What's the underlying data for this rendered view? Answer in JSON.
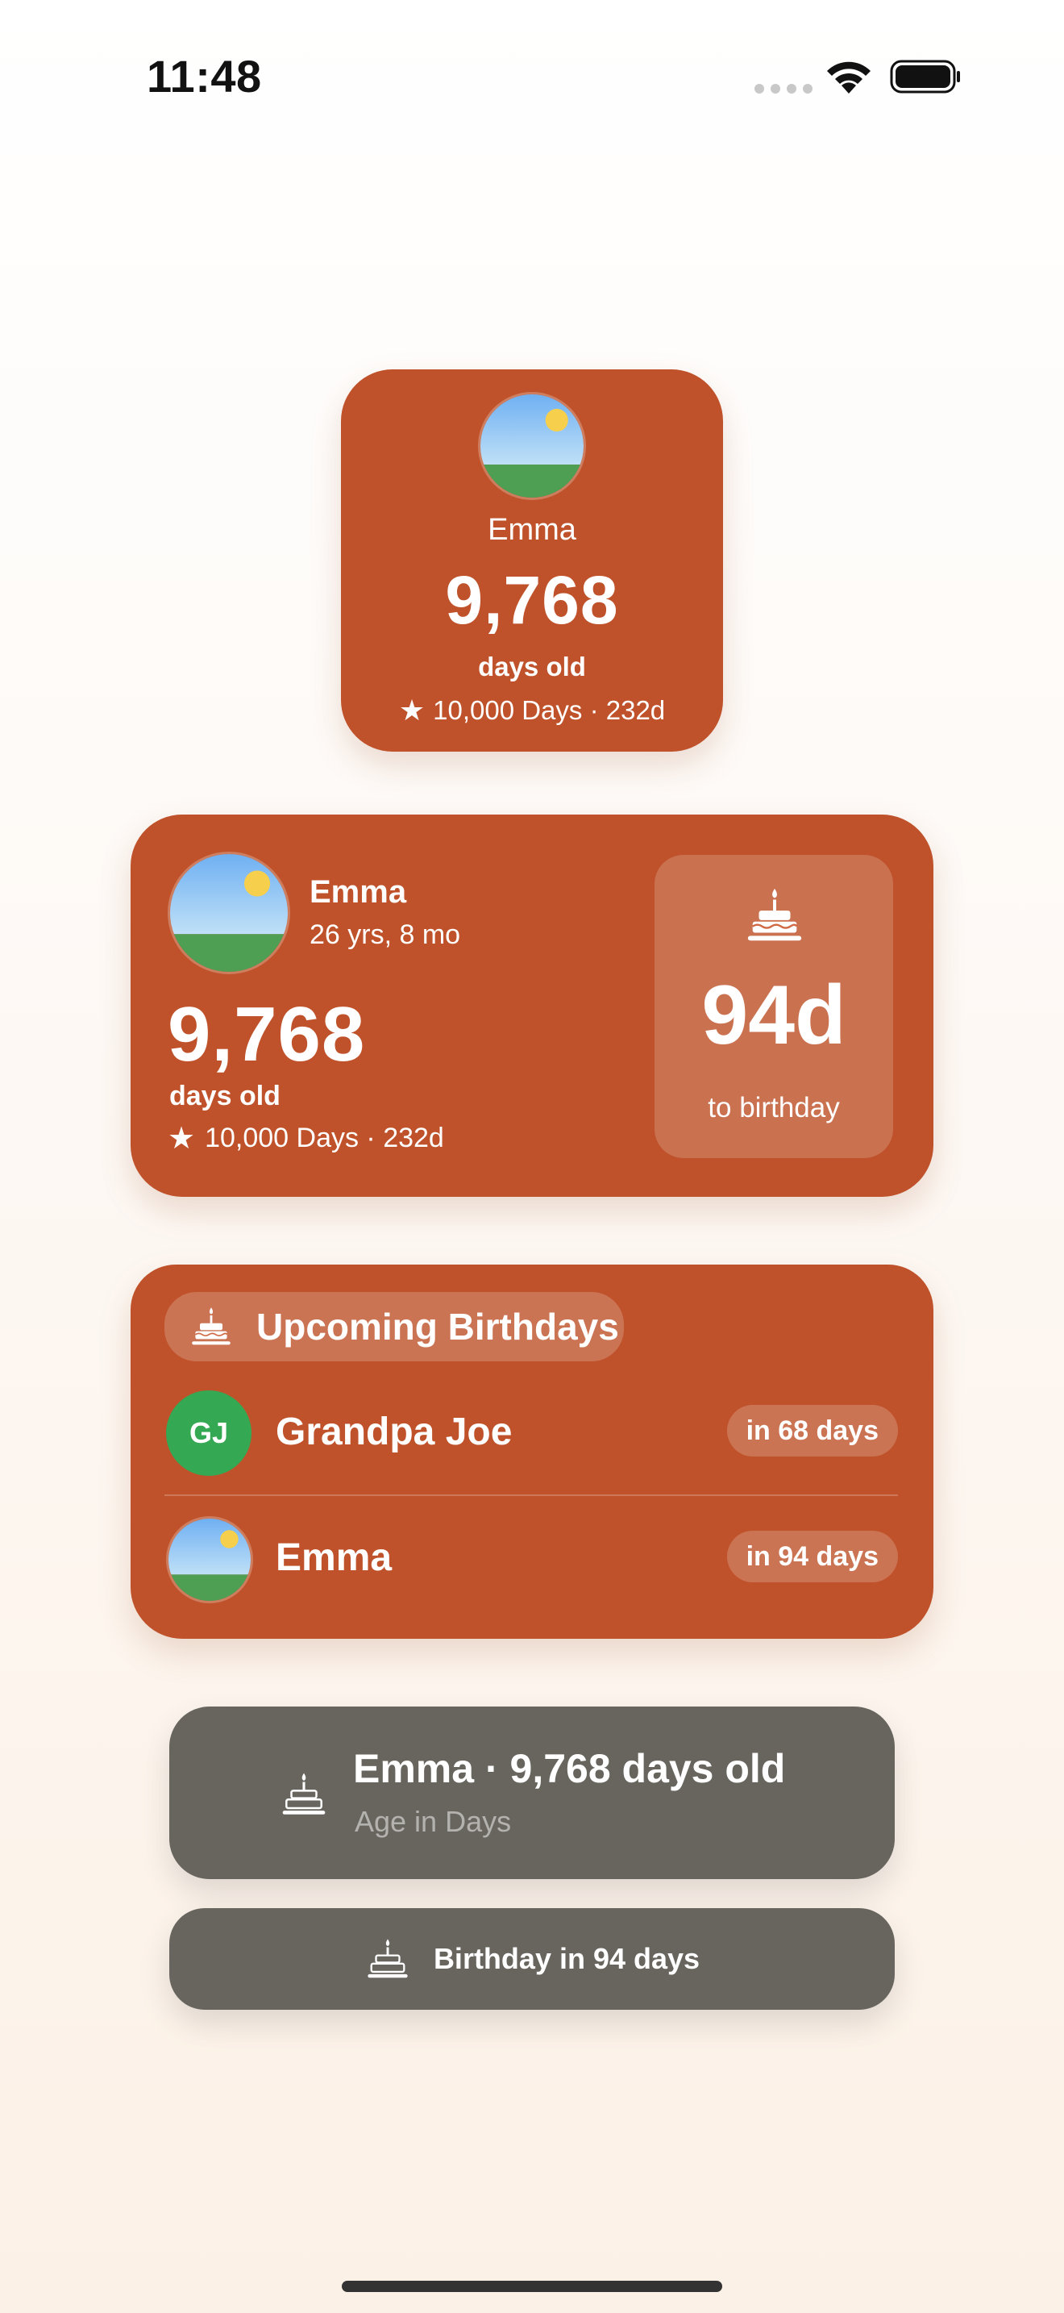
{
  "status_bar": {
    "time": "11:48"
  },
  "small_widget": {
    "name": "Emma",
    "days": "9,768",
    "days_label": "days old",
    "milestone": "10,000 Days · 232d"
  },
  "medium_widget": {
    "name": "Emma",
    "age": "26 yrs, 8 mo",
    "days": "9,768",
    "days_label": "days old",
    "milestone": "10,000 Days · 232d",
    "countdown": "94d",
    "countdown_label": "to birthday"
  },
  "large_widget": {
    "title": "Upcoming Birthdays",
    "items": [
      {
        "initials": "GJ",
        "name": "Grandpa Joe",
        "when": "in 68 days"
      },
      {
        "name": "Emma",
        "when": "in 94 days"
      }
    ]
  },
  "accessory_rect": {
    "title": "Emma · 9,768 days old",
    "subtitle": "Age in Days"
  },
  "accessory_inline": {
    "text": "Birthday in 94 days"
  },
  "colors": {
    "widget_bg": "#bf522a",
    "accessory_bg": "#68655f",
    "initials_avatar": "#34a853"
  }
}
